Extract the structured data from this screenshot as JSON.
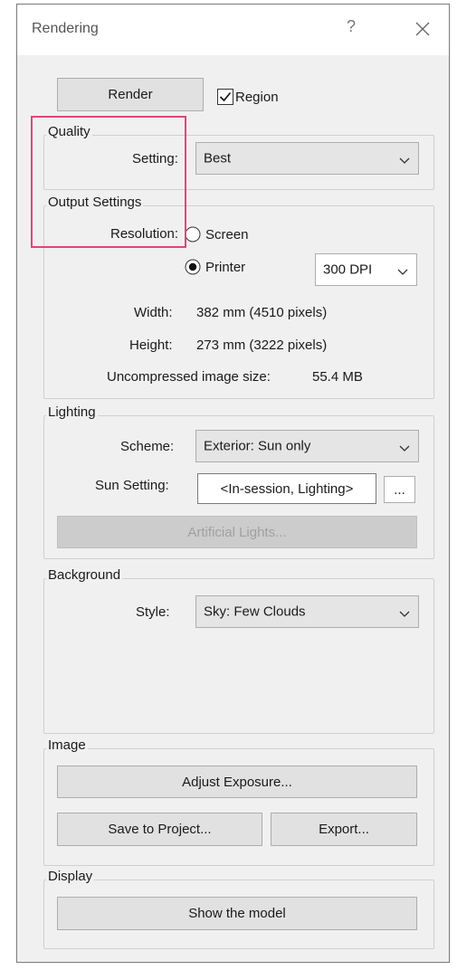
{
  "window": {
    "title": "Rendering",
    "help_glyph": "?"
  },
  "render_button_label": "Render",
  "region_checkbox": {
    "label": "Region",
    "checked": true
  },
  "quality": {
    "group_label": "Quality",
    "setting_label": "Setting:",
    "setting_value": "Best"
  },
  "output": {
    "group_label": "Output Settings",
    "resolution_label": "Resolution:",
    "screen_label": "Screen",
    "printer_label": "Printer",
    "selected": "Printer",
    "dpi_value": "300 DPI",
    "width_label": "Width:",
    "width_value": "382 mm (4510 pixels)",
    "height_label": "Height:",
    "height_value": "273 mm (3222 pixels)",
    "size_label": "Uncompressed image size:",
    "size_value": "55.4 MB"
  },
  "lighting": {
    "group_label": "Lighting",
    "scheme_label": "Scheme:",
    "scheme_value": "Exterior: Sun only",
    "sun_label": "Sun Setting:",
    "sun_value": "<In-session, Lighting>",
    "sun_browse_label": "...",
    "artificial_label": "Artificial Lights..."
  },
  "background": {
    "group_label": "Background",
    "style_label": "Style:",
    "style_value": "Sky: Few Clouds"
  },
  "image": {
    "group_label": "Image",
    "adjust_label": "Adjust Exposure...",
    "save_label": "Save to Project...",
    "export_label": "Export..."
  },
  "display": {
    "group_label": "Display",
    "show_model_label": "Show the model"
  },
  "colors": {
    "highlight": "#e0457b",
    "dialog_bg": "#f0f0f0",
    "button_bg": "#e1e1e1"
  }
}
